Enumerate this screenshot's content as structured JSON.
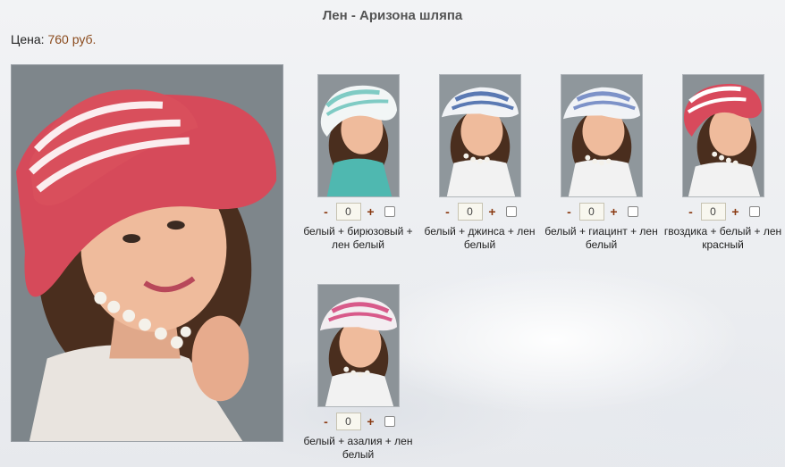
{
  "product": {
    "title": "Лен - Аризона шляпа",
    "price_label": "Цена:",
    "price_value": "760 руб."
  },
  "main_photo": {
    "hat_crown": "#d64a5a",
    "hat_stripe": "#ffffff"
  },
  "variants": [
    {
      "label": "белый + бирюзовый + лен белый",
      "qty": "0",
      "minus": "-",
      "plus": "+",
      "hat_color": "#f2f6f6",
      "stripe_color": "#7fcbc4",
      "top_color": "#4fb8b0"
    },
    {
      "label": "белый + джинса + лен белый",
      "qty": "0",
      "minus": "-",
      "plus": "+",
      "hat_color": "#f1f3f6",
      "stripe_color": "#5a79b3",
      "top_color": "#f2f2f2"
    },
    {
      "label": "белый + гиацинт + лен белый",
      "qty": "0",
      "minus": "-",
      "plus": "+",
      "hat_color": "#f1f3f6",
      "stripe_color": "#7d92c8",
      "top_color": "#f2f2f2"
    },
    {
      "label": "гвоздика + белый + лен красный",
      "qty": "0",
      "minus": "-",
      "plus": "+",
      "hat_color": "#d84a5c",
      "stripe_color": "#ffffff",
      "top_color": "#f2f2f2"
    },
    {
      "label": "белый + азалия + лен белый",
      "qty": "0",
      "minus": "-",
      "plus": "+",
      "hat_color": "#f3eef1",
      "stripe_color": "#d85a8a",
      "top_color": "#f2f2f2"
    }
  ]
}
